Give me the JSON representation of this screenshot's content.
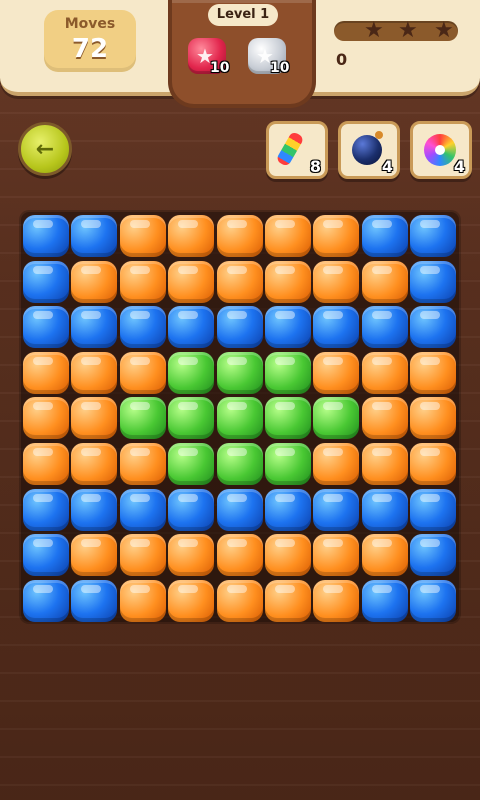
{
  "header": {
    "moves_label": "Moves",
    "moves_value": "72",
    "level_label": "Level 1",
    "goals": [
      {
        "type": "red-gem",
        "count": "10"
      },
      {
        "type": "silver-gem",
        "count": "10"
      }
    ],
    "stars_filled": 0,
    "stars_total": 3,
    "score": "0"
  },
  "boosters": [
    {
      "name": "rocket",
      "count": "8"
    },
    {
      "name": "bomb",
      "count": "4"
    },
    {
      "name": "rainbow",
      "count": "4"
    }
  ],
  "board": {
    "rows": 9,
    "cols": 9,
    "grid": [
      [
        "blue",
        "blue",
        "orange",
        "orange",
        "orange",
        "orange",
        "orange",
        "blue",
        "blue"
      ],
      [
        "blue",
        "orange",
        "orange",
        "orange",
        "orange",
        "orange",
        "orange",
        "orange",
        "blue"
      ],
      [
        "blue",
        "blue",
        "blue",
        "blue",
        "blue",
        "blue",
        "blue",
        "blue",
        "blue"
      ],
      [
        "orange",
        "orange",
        "orange",
        "green",
        "green",
        "green",
        "orange",
        "orange",
        "orange"
      ],
      [
        "orange",
        "orange",
        "green",
        "green",
        "green",
        "green",
        "green",
        "orange",
        "orange"
      ],
      [
        "orange",
        "orange",
        "orange",
        "green",
        "green",
        "green",
        "orange",
        "orange",
        "orange"
      ],
      [
        "blue",
        "blue",
        "blue",
        "blue",
        "blue",
        "blue",
        "blue",
        "blue",
        "blue"
      ],
      [
        "blue",
        "orange",
        "orange",
        "orange",
        "orange",
        "orange",
        "orange",
        "orange",
        "blue"
      ],
      [
        "blue",
        "blue",
        "orange",
        "orange",
        "orange",
        "orange",
        "orange",
        "blue",
        "blue"
      ]
    ]
  },
  "colors": {
    "accent": "#f6e8c9",
    "background": "#5a301f"
  }
}
